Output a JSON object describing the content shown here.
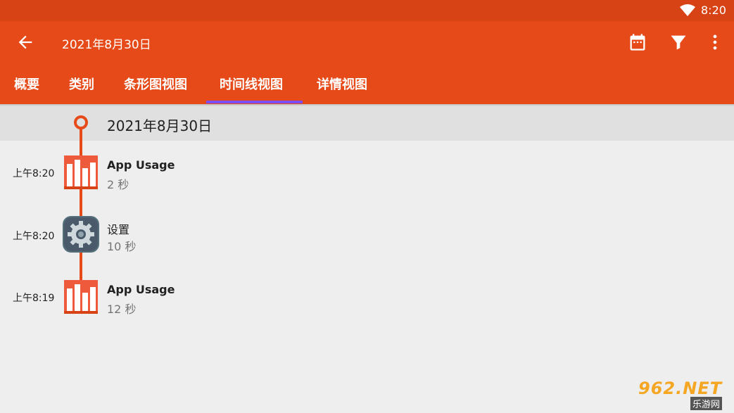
{
  "status_bar": {
    "time": "8:20"
  },
  "toolbar": {
    "title": "2021年8月30日",
    "icons": [
      "arrow-left-icon",
      "calendar-icon",
      "filter-icon",
      "more-vert-icon"
    ]
  },
  "tabs": [
    {
      "label": "概要"
    },
    {
      "label": "类别"
    },
    {
      "label": "条形图视图"
    },
    {
      "label": "时间线视图",
      "selected": true
    },
    {
      "label": "详情视图"
    }
  ],
  "timeline": {
    "date": "2021年8月30日",
    "entries": [
      {
        "time": "上午8:20",
        "app": "App Usage",
        "duration": "2 秒",
        "icon": "app-usage-icon"
      },
      {
        "time": "上午8:20",
        "app": "设置",
        "duration": "10 秒",
        "icon": "settings-gear-icon"
      },
      {
        "time": "上午8:19",
        "app": "App Usage",
        "duration": "12 秒",
        "icon": "app-usage-icon"
      }
    ]
  },
  "watermark": {
    "main": "962.NET",
    "sub": "乐游网"
  },
  "colors": {
    "primary": "#e64a19",
    "primary_dark": "#d84315",
    "indicator": "#7c4dff",
    "background": "#eeeeee",
    "header": "#e0e0e0"
  }
}
